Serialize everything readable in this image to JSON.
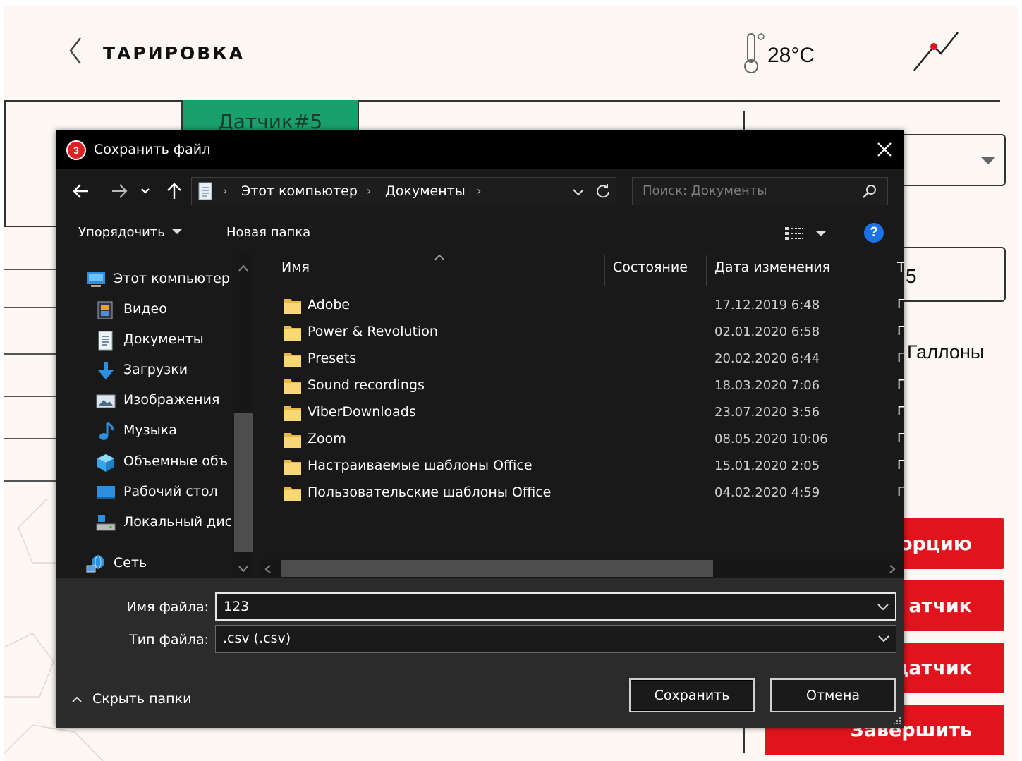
{
  "app": {
    "title": "ТАРИРОВКА",
    "temperature": "28°C",
    "sensor_tab": "Датчик#5",
    "field_value": "5",
    "unit": "Галлоны",
    "buttons": [
      "орцию",
      "атчик",
      "датчик",
      "Завершить"
    ],
    "colors": {
      "accent_red": "#e1141e",
      "tab_green": "#19a06b",
      "background": "#fdf8f4"
    }
  },
  "dialog": {
    "title": "Сохранить файл",
    "breadcrumb": [
      "Этот компьютер",
      "Документы"
    ],
    "search_placeholder": "Поиск: Документы",
    "toolbar": {
      "organize": "Упорядочить",
      "new_folder": "Новая папка",
      "help": "?"
    },
    "nav_items": [
      {
        "label": "Этот компьютер",
        "icon": "computer-icon"
      },
      {
        "label": "Видео",
        "icon": "video-icon"
      },
      {
        "label": "Документы",
        "icon": "documents-icon"
      },
      {
        "label": "Загрузки",
        "icon": "downloads-icon"
      },
      {
        "label": "Изображения",
        "icon": "images-icon"
      },
      {
        "label": "Музыка",
        "icon": "music-icon"
      },
      {
        "label": "Объемные объ",
        "icon": "3d-objects-icon"
      },
      {
        "label": "Рабочий стол",
        "icon": "desktop-icon"
      },
      {
        "label": "Локальный дис",
        "icon": "local-disk-icon"
      },
      {
        "label": "Сеть",
        "icon": "network-icon"
      }
    ],
    "columns": {
      "name": "Имя",
      "status": "Состояние",
      "date": "Дата изменения",
      "type": "Т"
    },
    "files": [
      {
        "name": "Adobe",
        "date": "17.12.2019 6:48",
        "type": "Г"
      },
      {
        "name": "Power & Revolution",
        "date": "02.01.2020 6:58",
        "type": "Г"
      },
      {
        "name": "Presets",
        "date": "20.02.2020 6:44",
        "type": "Г"
      },
      {
        "name": "Sound recordings",
        "date": "18.03.2020 7:06",
        "type": "Г"
      },
      {
        "name": "ViberDownloads",
        "date": "23.07.2020 3:56",
        "type": "Г"
      },
      {
        "name": "Zoom",
        "date": "08.05.2020 10:06",
        "type": "Г"
      },
      {
        "name": "Настраиваемые шаблоны Office",
        "date": "15.01.2020 2:05",
        "type": "Г"
      },
      {
        "name": "Пользовательские шаблоны Office",
        "date": "04.02.2020 4:59",
        "type": "Г"
      }
    ],
    "filename_label": "Имя файла:",
    "filename_value": "123",
    "filetype_label": "Тип файла:",
    "filetype_value": ".csv (.csv)",
    "hide_folders": "Скрыть папки",
    "save": "Сохранить",
    "cancel": "Отмена"
  }
}
